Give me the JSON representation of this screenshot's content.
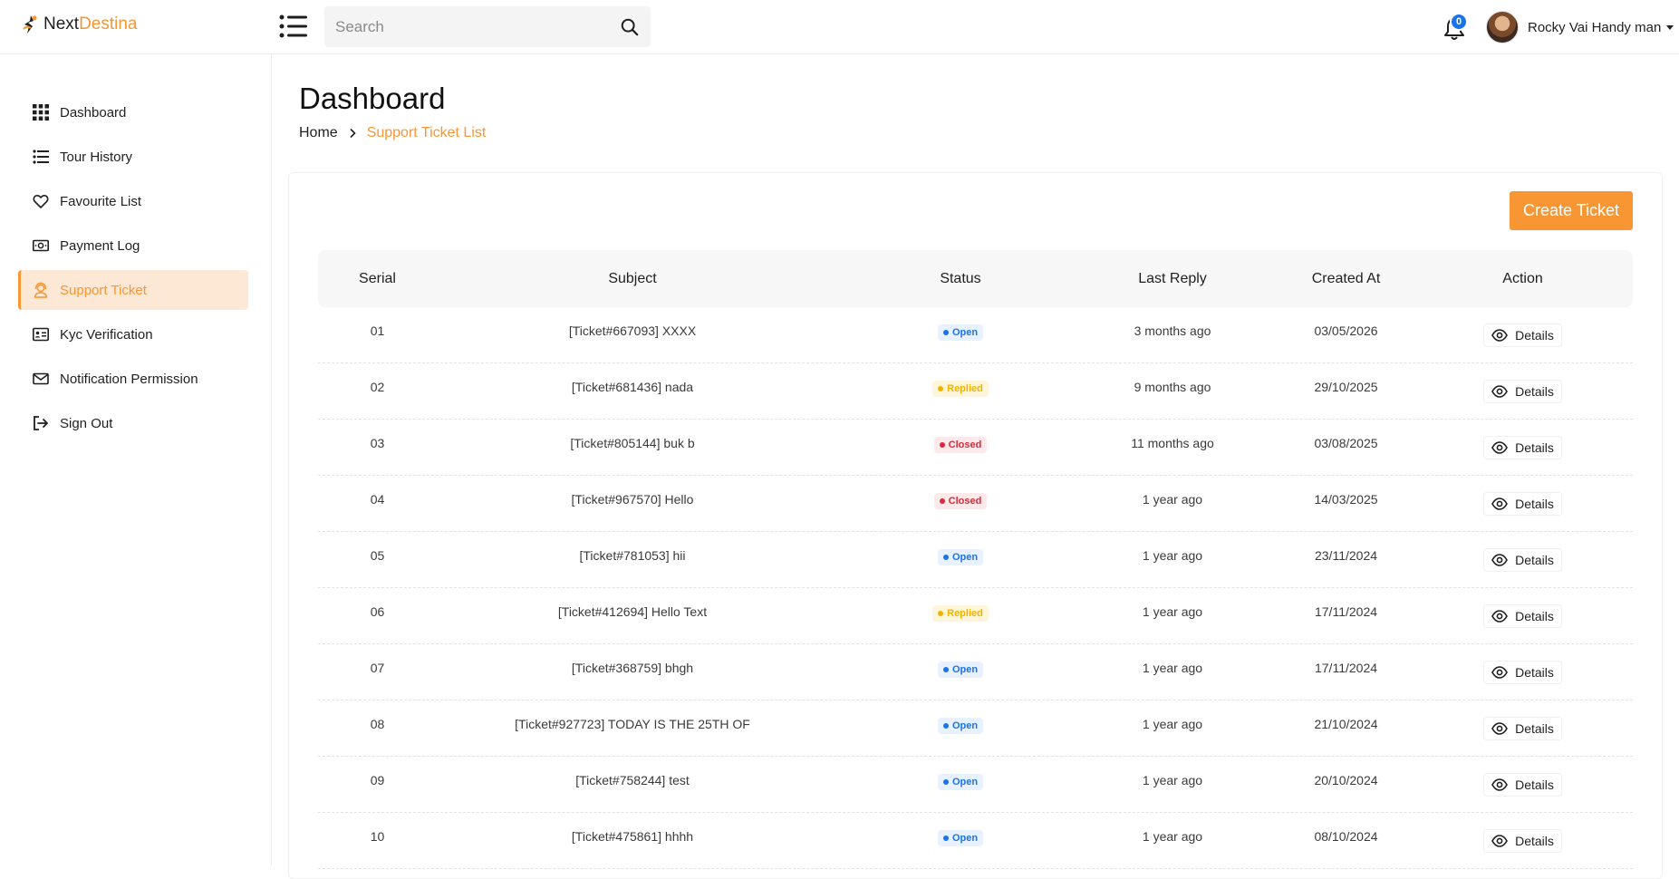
{
  "brand": {
    "name_part1": "Next",
    "name_part2": "Destina",
    "accent": "#f79633"
  },
  "header": {
    "search_placeholder": "Search",
    "notification_count": "0",
    "user_name": "Rocky Vai Handy man"
  },
  "sidebar": {
    "items": [
      {
        "label": "Dashboard",
        "icon": "grid-icon"
      },
      {
        "label": "Tour History",
        "icon": "list-icon"
      },
      {
        "label": "Favourite List",
        "icon": "heart-icon"
      },
      {
        "label": "Payment Log",
        "icon": "money-icon"
      },
      {
        "label": "Support Ticket",
        "icon": "support-icon",
        "active": true
      },
      {
        "label": "Kyc Verification",
        "icon": "id-card-icon"
      },
      {
        "label": "Notification Permission",
        "icon": "envelope-icon"
      },
      {
        "label": "Sign Out",
        "icon": "sign-out-icon"
      }
    ]
  },
  "page": {
    "title": "Dashboard",
    "breadcrumb_home": "Home",
    "breadcrumb_current": "Support Ticket List",
    "create_button": "Create Ticket"
  },
  "table": {
    "headers": [
      "Serial",
      "Subject",
      "Status",
      "Last Reply",
      "Created At",
      "Action"
    ],
    "action_label": "Details",
    "status_colors": {
      "Open": {
        "bg": "#e8f1ff",
        "fg": "#1a73e8"
      },
      "Replied": {
        "bg": "#fff6da",
        "fg": "#f0b400"
      },
      "Closed": {
        "bg": "#fde8ea",
        "fg": "#d92b3a"
      }
    },
    "rows": [
      {
        "serial": "01",
        "subject": "[Ticket#667093] XXXX",
        "status": "Open",
        "last_reply": "3 months ago",
        "created_at": "03/05/2026"
      },
      {
        "serial": "02",
        "subject": "[Ticket#681436] nada",
        "status": "Replied",
        "last_reply": "9 months ago",
        "created_at": "29/10/2025"
      },
      {
        "serial": "03",
        "subject": "[Ticket#805144] buk b",
        "status": "Closed",
        "last_reply": "11 months ago",
        "created_at": "03/08/2025"
      },
      {
        "serial": "04",
        "subject": "[Ticket#967570] Hello",
        "status": "Closed",
        "last_reply": "1 year ago",
        "created_at": "14/03/2025"
      },
      {
        "serial": "05",
        "subject": "[Ticket#781053] hii",
        "status": "Open",
        "last_reply": "1 year ago",
        "created_at": "23/11/2024"
      },
      {
        "serial": "06",
        "subject": "[Ticket#412694] Hello Text",
        "status": "Replied",
        "last_reply": "1 year ago",
        "created_at": "17/11/2024"
      },
      {
        "serial": "07",
        "subject": "[Ticket#368759] bhgh",
        "status": "Open",
        "last_reply": "1 year ago",
        "created_at": "17/11/2024"
      },
      {
        "serial": "08",
        "subject": "[Ticket#927723] TODAY IS THE 25TH OF",
        "status": "Open",
        "last_reply": "1 year ago",
        "created_at": "21/10/2024"
      },
      {
        "serial": "09",
        "subject": "[Ticket#758244] test",
        "status": "Open",
        "last_reply": "1 year ago",
        "created_at": "20/10/2024"
      },
      {
        "serial": "10",
        "subject": "[Ticket#475861] hhhh",
        "status": "Open",
        "last_reply": "1 year ago",
        "created_at": "08/10/2024"
      }
    ]
  }
}
